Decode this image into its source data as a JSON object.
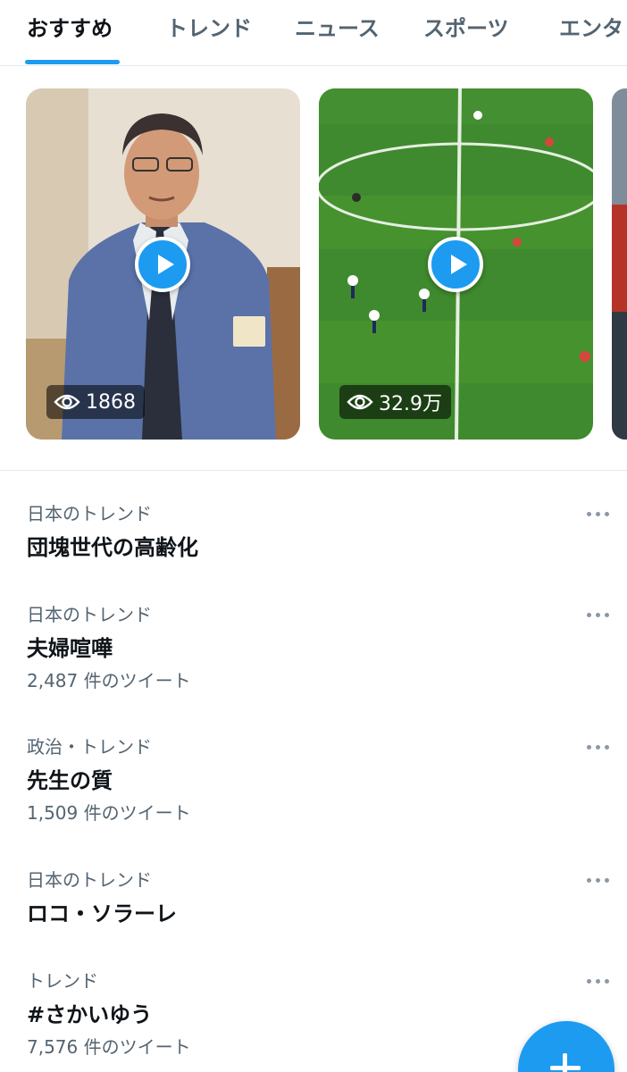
{
  "tabs": [
    {
      "label": "おすすめ",
      "active": true
    },
    {
      "label": "トレンド",
      "active": false
    },
    {
      "label": "ニュース",
      "active": false
    },
    {
      "label": "スポーツ",
      "active": false
    },
    {
      "label": "エンタ",
      "active": false
    }
  ],
  "videos": [
    {
      "views": "1868",
      "icon": "play-icon"
    },
    {
      "views": "32.9万",
      "icon": "play-icon"
    }
  ],
  "trends": [
    {
      "context": "日本のトレンド",
      "title": "団塊世代の高齢化",
      "count": ""
    },
    {
      "context": "日本のトレンド",
      "title": "夫婦喧嘩",
      "count": "2,487 件のツイート"
    },
    {
      "context": "政治・トレンド",
      "title": "先生の質",
      "count": "1,509 件のツイート"
    },
    {
      "context": "日本のトレンド",
      "title": "ロコ・ソラーレ",
      "count": ""
    },
    {
      "context": "トレンド",
      "title": "#さかいゆう",
      "count": "7,576 件のツイート"
    }
  ],
  "colors": {
    "accent": "#1d9bf0",
    "text_primary": "#0f1419",
    "text_secondary": "#536471"
  }
}
